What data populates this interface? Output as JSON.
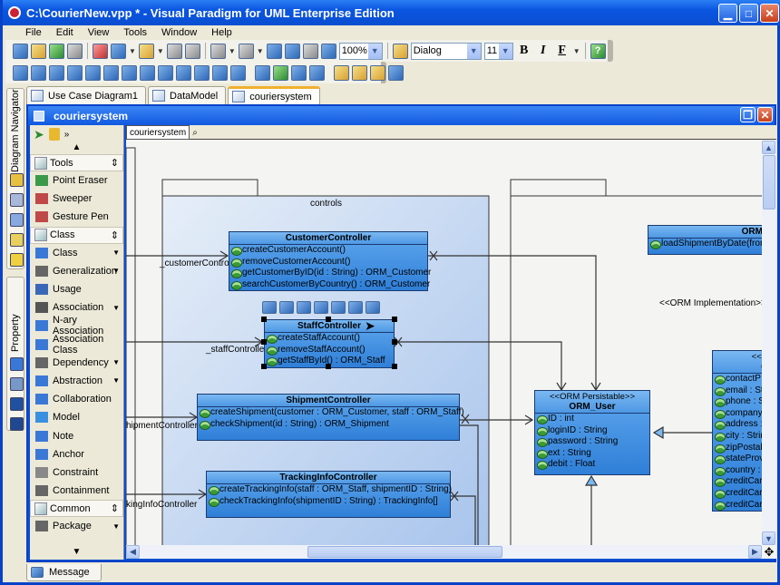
{
  "window": {
    "title": "C:\\CourierNew.vpp * - Visual Paradigm for UML Enterprise Edition",
    "buttons": [
      "minimize",
      "maximize",
      "close"
    ]
  },
  "menu": [
    "File",
    "Edit",
    "View",
    "Tools",
    "Window",
    "Help"
  ],
  "toolbar": {
    "zoom_value": "100%",
    "font_name": "Dialog",
    "font_size": "11",
    "bold_label": "B",
    "italic_label": "I",
    "font_color_label": "F",
    "help_label": "?"
  },
  "side_tabs": [
    "Diagram Navigator",
    "Property"
  ],
  "doc_tabs": [
    {
      "label": "Use Case Diagram1",
      "active": false
    },
    {
      "label": "DataModel",
      "active": false
    },
    {
      "label": "couriersystem",
      "active": true
    }
  ],
  "diagram_window": {
    "title": "couriersystem",
    "canvas_tab": "couriersystem"
  },
  "palette": {
    "groups": [
      {
        "name": "Tools",
        "items": [
          {
            "label": "Point Eraser",
            "has_dropdown": false
          },
          {
            "label": "Sweeper",
            "has_dropdown": false
          },
          {
            "label": "Gesture Pen",
            "has_dropdown": false
          }
        ]
      },
      {
        "name": "Class",
        "items": [
          {
            "label": "Class",
            "has_dropdown": true
          },
          {
            "label": "Generalization",
            "has_dropdown": true
          },
          {
            "label": "Usage",
            "has_dropdown": false
          },
          {
            "label": "Association",
            "has_dropdown": true
          },
          {
            "label": "N-ary Association",
            "has_dropdown": false
          },
          {
            "label": "Association Class",
            "has_dropdown": false
          },
          {
            "label": "Dependency",
            "has_dropdown": true
          },
          {
            "label": "Abstraction",
            "has_dropdown": true
          },
          {
            "label": "Collaboration",
            "has_dropdown": false
          },
          {
            "label": "Model",
            "has_dropdown": false
          },
          {
            "label": "Note",
            "has_dropdown": false
          },
          {
            "label": "Anchor",
            "has_dropdown": false
          },
          {
            "label": "Constraint",
            "has_dropdown": false
          },
          {
            "label": "Containment",
            "has_dropdown": false
          }
        ]
      },
      {
        "name": "Common",
        "items": [
          {
            "label": "Package",
            "has_dropdown": true
          }
        ]
      }
    ]
  },
  "diagram": {
    "package_name": "controls",
    "classes": [
      {
        "name": "CustomerController",
        "members": [
          "createCustomerAccount()",
          "removeCustomerAccount()",
          "getCustomerByID(id : String) : ORM_Customer",
          "searchCustomerByCountry() : ORM_Customer"
        ]
      },
      {
        "name": "StaffController",
        "members": [
          "createStaffAccount()",
          "removeStaffAccount()",
          "getStaffById() : ORM_Staff"
        ]
      },
      {
        "name": "ShipmentController",
        "members": [
          "createShipment(customer : ORM_Customer, staff : ORM_Staff)",
          "checkShipment(id : String) : ORM_Shipment"
        ]
      },
      {
        "name": "TrackingInfoController",
        "members": [
          "createTrackingInfo(staff : ORM_Staff, shipmentID : String)",
          "checkTrackingInfo(shipmentID : String) : TrackingInfo[]"
        ]
      },
      {
        "name": "ORM_User",
        "stereotype": "<<ORM Persistable>>",
        "members": [
          "ID : int",
          "loginID : String",
          "password : String",
          "ext : String",
          "debit : Float"
        ]
      },
      {
        "name": "ORM",
        "members": [
          "loadShipmentByDate(from"
        ]
      },
      {
        "name": "OR",
        "stereotype": "<<OR",
        "members": [
          "contactP",
          "email : St",
          "phone : S",
          "company",
          "address :",
          "city : Strir",
          "zipPostal",
          "stateProv",
          "country :",
          "creditCar",
          "creditCar",
          "creditCar"
        ]
      }
    ],
    "role_labels": [
      "_customerController",
      "_staffController",
      "hipmentController",
      "kingInfoController"
    ],
    "stereotype_label": "<<ORM Implementation>>"
  },
  "bottom_tabs": [
    "Message"
  ]
}
